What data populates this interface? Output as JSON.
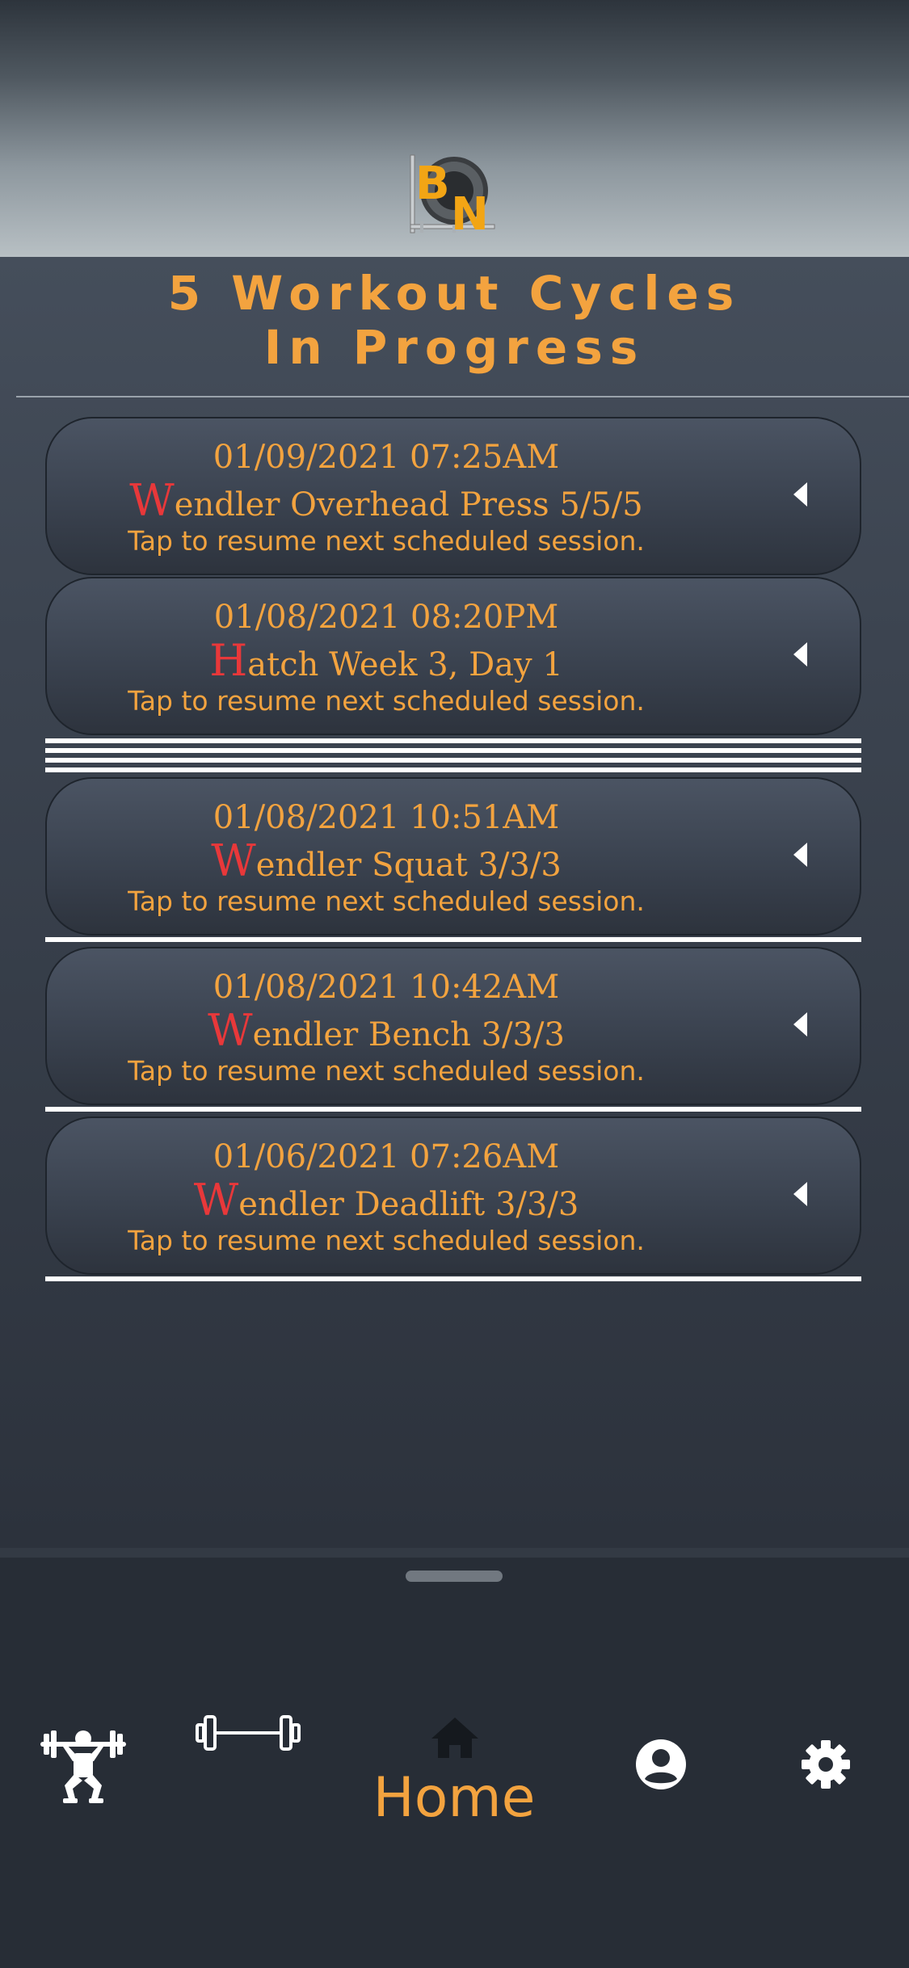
{
  "header": {
    "logo_text": "BN",
    "title_line1": "5 Workout Cycles",
    "title_line2": "In Progress"
  },
  "cycles": [
    {
      "date": "01/09/2021 07:25AM",
      "initial": "W",
      "name_rest": "endler Overhead Press 5/5/5",
      "hint": "Tap to resume next scheduled session."
    },
    {
      "date": "01/08/2021 08:20PM",
      "initial": "H",
      "name_rest": "atch Week 3, Day 1",
      "hint": "Tap to resume next scheduled session."
    },
    {
      "date": "01/08/2021 10:51AM",
      "initial": "W",
      "name_rest": "endler Squat 3/3/3",
      "hint": "Tap to resume next scheduled session."
    },
    {
      "date": "01/08/2021 10:42AM",
      "initial": "W",
      "name_rest": "endler Bench 3/3/3",
      "hint": "Tap to resume next scheduled session."
    },
    {
      "date": "01/06/2021 07:26AM",
      "initial": "W",
      "name_rest": "endler Deadlift 3/3/3",
      "hint": "Tap to resume next scheduled session."
    }
  ],
  "tabbar": {
    "active_label": "Home",
    "tabs": [
      {
        "icon": "weightlifter-icon"
      },
      {
        "icon": "barbell-icon"
      },
      {
        "icon": "home-icon"
      },
      {
        "icon": "profile-icon"
      },
      {
        "icon": "settings-gear-icon"
      }
    ]
  },
  "colors": {
    "accent": "#f3a33f",
    "initial_red": "#e8383a",
    "background": "#2f3641"
  }
}
